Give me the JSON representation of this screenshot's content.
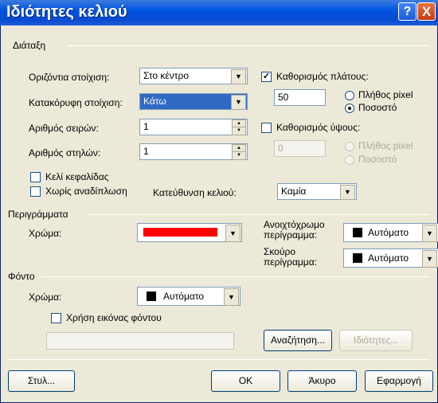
{
  "title": "Ιδιότητες κελιού",
  "titlebar": {
    "help_glyph": "?",
    "close_glyph": "X"
  },
  "layout": {
    "group": "Διάταξη",
    "halign_label": "Οριζόντια στοίχιση:",
    "halign_value": "Στο κέντρο",
    "valign_label": "Κατακόρυφη στοίχιση:",
    "valign_value": "Κάτω",
    "rows_label": "Αριθμός σειρών:",
    "rows_value": "1",
    "cols_label": "Αριθμός στηλών:",
    "cols_value": "1",
    "width_check_label": "Καθορισμός πλάτους:",
    "width_value": "50",
    "width_pixels_label": "Πλήθος pixel",
    "width_percent_label": "Ποσοστό",
    "height_check_label": "Καθορισμός ύψους:",
    "height_value": "0",
    "height_pixels_label": "Πλήθος pixel",
    "height_percent_label": "Ποσοστό",
    "header_cell_label": "Κελί κεφαλίδας",
    "nowrap_label": "Χωρίς αναδίπλωση",
    "direction_label": "Κατεύθυνση κελιού:",
    "direction_value": "Καμία"
  },
  "borders": {
    "group": "Περιγράμματα",
    "color_label": "Χρώμα:",
    "color_value": "#ff0000",
    "light_label": "Ανοιχτόχρωμο περίγραμμα:",
    "light_value": "Αυτόματο",
    "dark_label": "Σκούρο περίγραμμα:",
    "dark_value": "Αυτόματο"
  },
  "background": {
    "group": "Φόντο",
    "color_label": "Χρώμα:",
    "color_value": "Αυτόματο",
    "image_check_label": "Χρήση εικόνας φόντου",
    "browse_label": "Αναζήτηση...",
    "properties_label": "Ιδιότητες..."
  },
  "footer": {
    "style_label": "Στυλ...",
    "ok_label": "OK",
    "cancel_label": "Άκυρο",
    "apply_label": "Εφαρμογή"
  },
  "check_glyph": "✓",
  "arrow_glyph": "▼",
  "spin_up": "▲",
  "spin_down": "▼"
}
